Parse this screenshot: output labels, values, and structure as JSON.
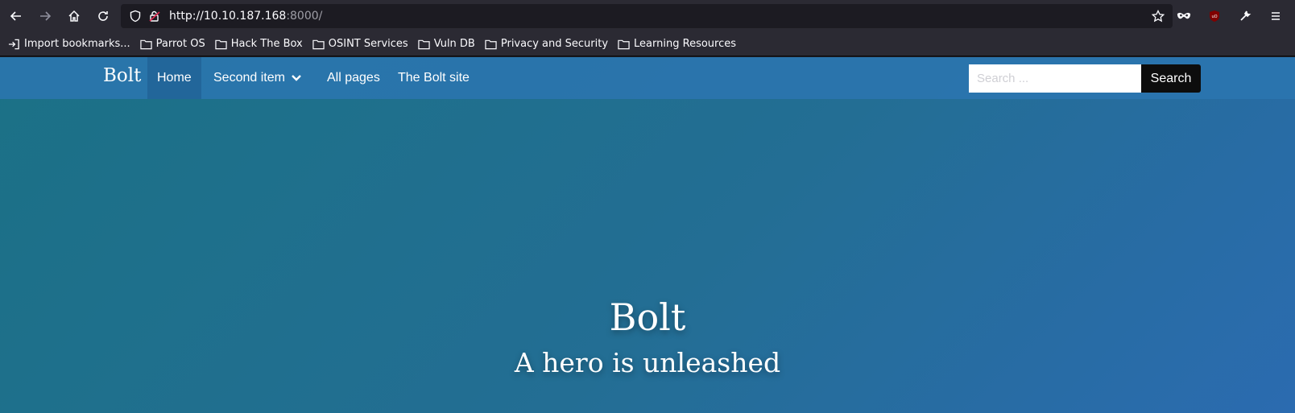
{
  "browser": {
    "url_host": "http://10.10.187.168",
    "url_port": ":8000/",
    "bookmarks": [
      {
        "label": "Import bookmarks...",
        "icon": "import-icon"
      },
      {
        "label": "Parrot OS",
        "icon": "folder-icon"
      },
      {
        "label": "Hack The Box",
        "icon": "folder-icon"
      },
      {
        "label": "OSINT Services",
        "icon": "folder-icon"
      },
      {
        "label": "Vuln DB",
        "icon": "folder-icon"
      },
      {
        "label": "Privacy and Security",
        "icon": "folder-icon"
      },
      {
        "label": "Learning Resources",
        "icon": "folder-icon"
      }
    ]
  },
  "site": {
    "brand": "Bolt",
    "nav": [
      {
        "label": "Home",
        "active": true
      },
      {
        "label": "Second item",
        "dropdown": true
      },
      {
        "label": "All pages"
      },
      {
        "label": "The Bolt site"
      }
    ],
    "search": {
      "placeholder": "Search ...",
      "button": "Search"
    },
    "hero": {
      "title": "Bolt",
      "subtitle": "A hero is unleashed"
    }
  }
}
